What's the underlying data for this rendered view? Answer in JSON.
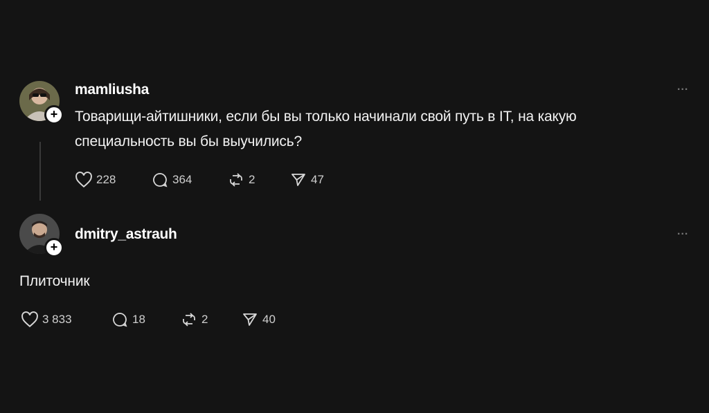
{
  "posts": [
    {
      "username": "mamliusha",
      "text_line1": "Товарищи-айтишники, если бы вы только начинали свой путь в IT, на какую",
      "text_line2": "специальность вы бы выучились?",
      "more": "...",
      "follow_glyph": "+",
      "likes": "228",
      "replies": "364",
      "reposts": "2",
      "shares": "47"
    },
    {
      "username": "dmitry_astrauh",
      "text": "Плиточник",
      "more": "...",
      "follow_glyph": "+",
      "likes": "3 833",
      "replies": "18",
      "reposts": "2",
      "shares": "40"
    }
  ],
  "icons": {
    "like": "heart-icon",
    "reply": "comment-icon",
    "repost": "repost-icon",
    "share": "send-icon",
    "more": "more-icon",
    "follow": "plus-icon"
  },
  "colors": {
    "background": "#141414",
    "text": "#f2f2f2",
    "muted": "#cfcfcf",
    "thread_line": "#3a3a3a"
  }
}
